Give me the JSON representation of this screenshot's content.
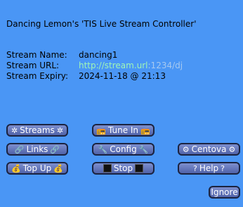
{
  "dialog": {
    "title": "Dancing Lemon's 'TIS Live Stream Controller'",
    "stream_name_label": "Stream Name:",
    "stream_name_value": "dancing1",
    "stream_url_label": "Stream URL:",
    "stream_url_link": "http://stream.url",
    "stream_url_rest": ":1234/dj",
    "stream_expiry_label": "Stream Expiry:",
    "stream_expiry_value": "2024-11-18 @ 21:13"
  },
  "buttons": {
    "streams": "Streams",
    "tune_in": "Tune In",
    "links": "Links",
    "config": "Config",
    "centova": "Centova",
    "top_up": "Top Up",
    "stop": "Stop",
    "help": "Help",
    "ignore": "Ignore"
  },
  "icons": {
    "streams": "gear-icon",
    "tune_in": "radio-icon",
    "links": "link-icon",
    "config": "wrench-icon",
    "centova": "settings-icon",
    "top_up": "money-bag-icon",
    "stop": "stop-square-icon",
    "help": "question-icon"
  },
  "colors": {
    "background": "#4a96f5",
    "button_fill": "#6072b8",
    "button_border": "#1b2340",
    "url_link": "#9ff5b6",
    "url_rest": "#a6c9f0"
  }
}
